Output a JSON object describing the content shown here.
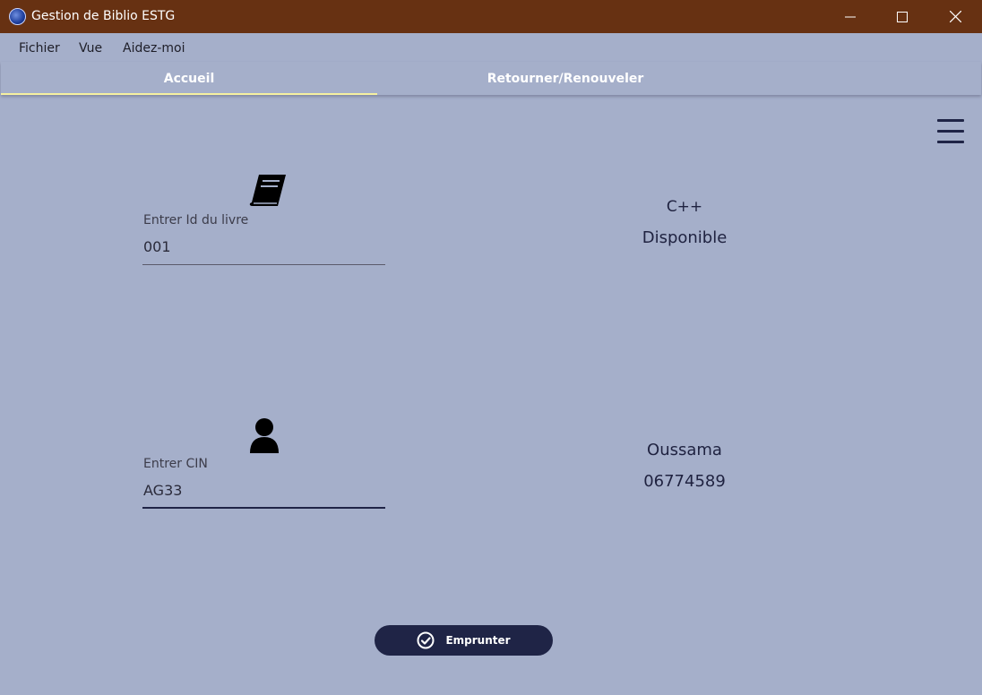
{
  "window": {
    "title": "Gestion de Biblio ESTG",
    "controls": [
      "minimize-icon",
      "maximize-icon",
      "close-icon"
    ]
  },
  "menu": {
    "items": [
      "Fichier",
      "Vue",
      "Aidez-moi"
    ]
  },
  "tabs": [
    {
      "label": "Accueil",
      "active": true
    },
    {
      "label": "Retourner/Renouveler",
      "active": false
    }
  ],
  "book": {
    "icon": "book-icon",
    "label": "Entrer Id du livre",
    "value": "001",
    "title": "C++",
    "status": "Disponible"
  },
  "user": {
    "icon": "user-icon",
    "label": "Entrer CIN",
    "value": "AG33",
    "name": "Oussama",
    "phone": "06774589"
  },
  "action": {
    "label": "Emprunter",
    "icon": "check-circle-icon"
  },
  "colors": {
    "titlebar": "#673112",
    "background": "#a5afca",
    "accent": "#1f2446",
    "tab_indicator": "#f5f0a0"
  }
}
